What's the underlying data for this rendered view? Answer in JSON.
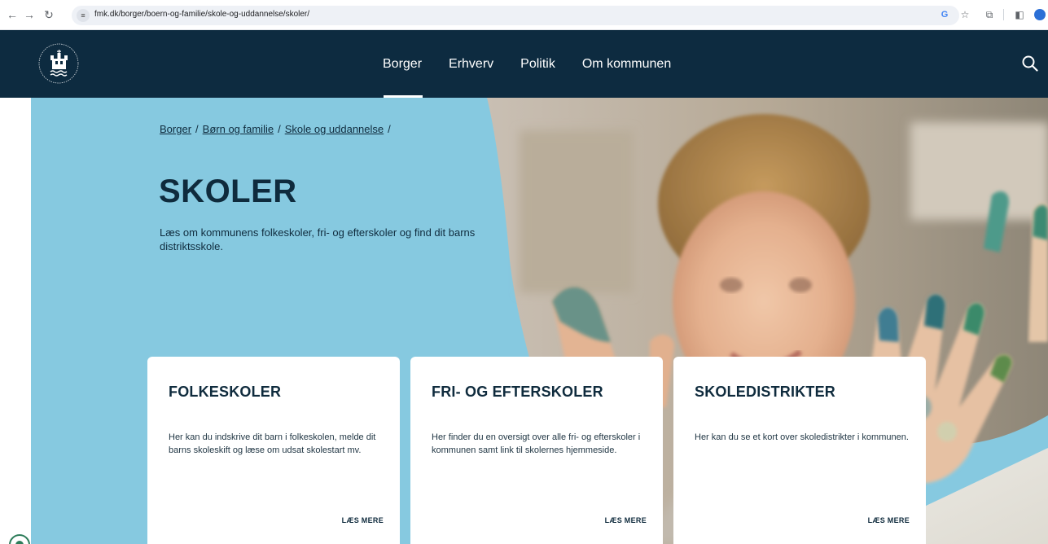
{
  "browser": {
    "url": "fmk.dk/borger/boern-og-familie/skole-og-uddannelse/skoler/"
  },
  "nav": {
    "items": [
      {
        "label": "Borger",
        "active": true
      },
      {
        "label": "Erhverv"
      },
      {
        "label": "Politik"
      },
      {
        "label": "Om kommunen"
      }
    ]
  },
  "breadcrumb": [
    "Borger",
    "Børn og familie",
    "Skole og uddannelse"
  ],
  "page": {
    "title": "SKOLER",
    "intro": "Læs om kommunens folkeskoler, fri- og efterskoler og find dit barns distriktsskole."
  },
  "cards": [
    {
      "title": "FOLKESKOLER",
      "text": "Her kan du indskrive dit barn i folkeskolen, melde dit barns skoleskift og læse om udsat skolestart mv.",
      "link": "LÆS MERE"
    },
    {
      "title": "FRI- OG EFTERSKOLER",
      "text": "Her finder du en oversigt over alle fri- og efterskoler i kommunen samt link til skolernes hjemmeside.",
      "link": "LÆS MERE"
    },
    {
      "title": "SKOLEDISTRIKTER",
      "text": "Her kan du se et kort over skoledistrikter i kommunen.",
      "link": "LÆS MERE"
    }
  ],
  "colors": {
    "header": "#0d2b40",
    "hero_blue": "#86c9e0",
    "text_dark": "#0f2b3d"
  }
}
